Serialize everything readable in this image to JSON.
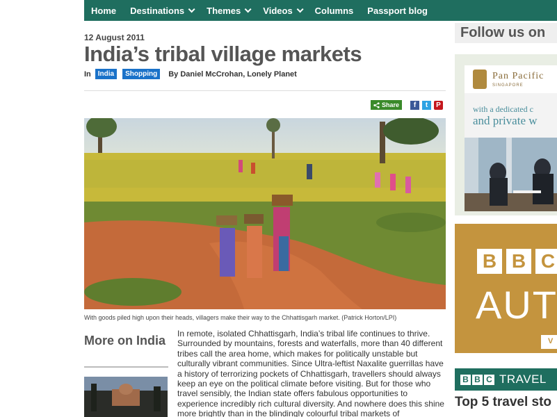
{
  "nav": {
    "items": [
      {
        "label": "Home",
        "has_dropdown": false
      },
      {
        "label": "Destinations",
        "has_dropdown": true
      },
      {
        "label": "Themes",
        "has_dropdown": true
      },
      {
        "label": "Videos",
        "has_dropdown": true
      },
      {
        "label": "Columns",
        "has_dropdown": false
      },
      {
        "label": "Passport blog",
        "has_dropdown": false
      }
    ]
  },
  "article": {
    "date": "12 August 2011",
    "title": "India’s tribal village markets",
    "byline": {
      "in_label": "In",
      "tags": [
        "India",
        "Shopping"
      ],
      "author": "By Daniel McCrohan, Lonely Planet"
    },
    "share_label": "Share",
    "social_icons": [
      "facebook-icon",
      "twitter-icon",
      "pinterest-icon"
    ],
    "caption": "With goods piled high upon their heads, villagers make their way to the Chhattisgarh market. (Patrick Horton/LPI)",
    "more_on": "More on India",
    "body": "In remote, isolated Chhattisgarh, India’s tribal life continues to thrive. Surrounded by mountains, forests and waterfalls, more than 40 different tribes call the area home, which makes for politically unstable but culturally vibrant communities. Since Ultra-leftist Naxalite guerrillas have a history of terrorizing pockets of Chhattisgarh, travellers should always keep an eye on the political climate before visiting. But for those who travel sensibly, the Indian state offers fabulous opportunities to experience incredibly rich cultural diversity. And nowhere does this shine more brightly than in the blindingly colourful tribal markets of"
  },
  "sidebar": {
    "follow_us": "Follow us on",
    "ad_pan_pacific": {
      "brand": "Pan Pacific",
      "location": "SINGAPORE",
      "line1": "with a dedicated c",
      "line2": "and private w"
    },
    "ad_bbc_autos": {
      "letters": [
        "B",
        "B",
        "C"
      ],
      "word": "AUT",
      "button": "V"
    },
    "bbc_travel": {
      "letters": [
        "B",
        "B",
        "C"
      ],
      "word": "TRAVEL"
    },
    "top5": "Top 5 travel sto"
  },
  "colors": {
    "brand_green": "#1f6e5f",
    "tag_blue": "#1a72c9",
    "share_green": "#3a8a2a",
    "ad_gold": "#c4943e"
  }
}
